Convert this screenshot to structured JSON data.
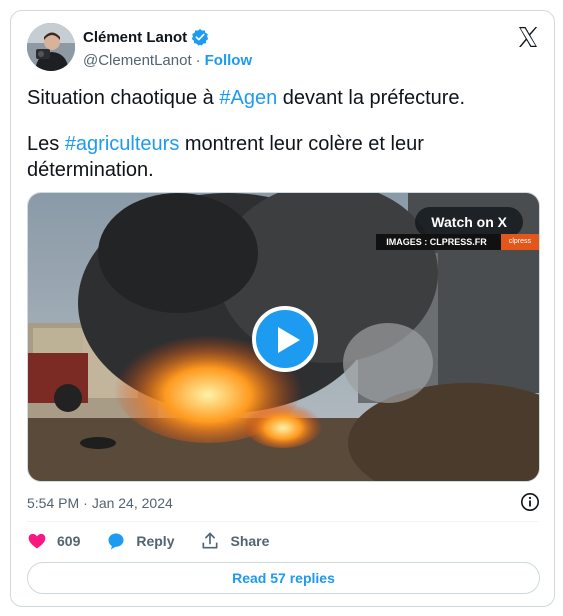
{
  "author": {
    "display_name": "Clément Lanot",
    "handle": "@ClementLanot",
    "separator": "·",
    "follow_label": "Follow"
  },
  "tweet": {
    "line1_before": "Situation chaotique à ",
    "line1_tag": "#Agen",
    "line1_after": " devant la préfecture.",
    "line2_before": "Les ",
    "line2_tag": "#agriculteurs",
    "line2_after": " montrent leur colère et leur détermination."
  },
  "media": {
    "watch_label": "Watch on X",
    "credit": "IMAGES : CLPRESS.FR",
    "credit_logo": "clpress"
  },
  "meta": {
    "time": "5:54 PM",
    "separator": "·",
    "date": "Jan 24, 2024"
  },
  "actions": {
    "like_count": "609",
    "reply_label": "Reply",
    "share_label": "Share"
  },
  "footer": {
    "read_replies_label": "Read 57 replies"
  },
  "colors": {
    "accent": "#1d9bf0",
    "like": "#f91880",
    "muted": "#536471"
  },
  "icons": [
    "verified-badge-icon",
    "x-logo-icon",
    "play-icon",
    "info-icon",
    "heart-icon",
    "reply-bubble-icon",
    "share-icon"
  ]
}
